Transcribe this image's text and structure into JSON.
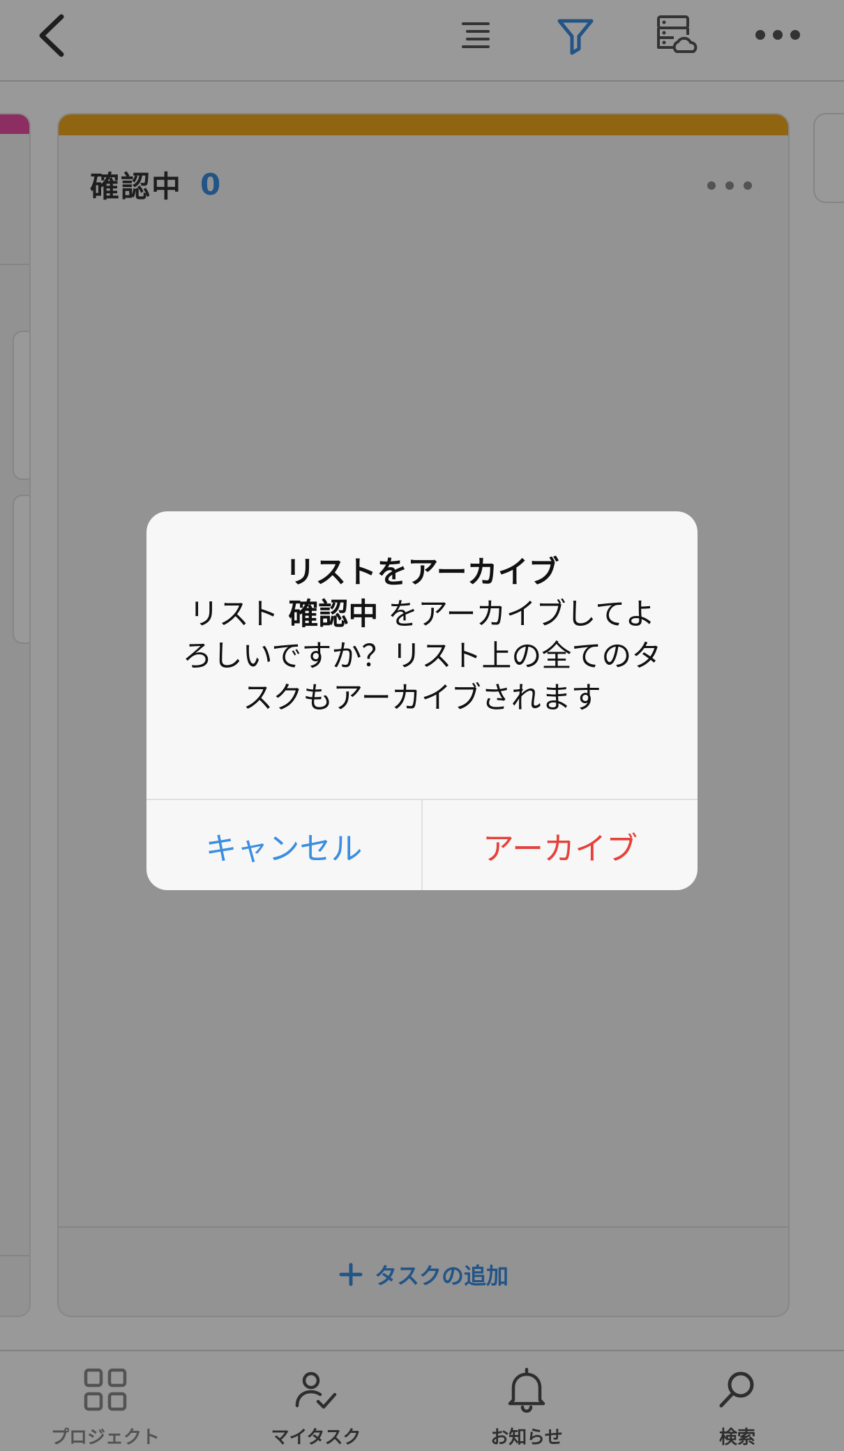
{
  "header": {
    "back_icon": "chevron-left-icon",
    "list_icon": "list-icon",
    "filter_icon": "filter-icon",
    "cloud_icon": "server-cloud-icon",
    "more_icon": "more-icon"
  },
  "column": {
    "title": "確認中",
    "count": "0",
    "add_task_label": "タスクの追加",
    "stripe_color": "#f0a81e"
  },
  "prev_column": {
    "stripe_color": "#e94ea2"
  },
  "dialog": {
    "title": "リストをアーカイブ",
    "message_prefix": "リスト ",
    "message_list_name": "確認中",
    "message_suffix": " をアーカイブしてよろしいですか？リスト上の全てのタスクもアーカイブされます",
    "cancel_label": "キャンセル",
    "confirm_label": "アーカイブ"
  },
  "bottom_nav": {
    "projects": "プロジェクト",
    "my_tasks": "マイタスク",
    "notifications": "お知らせ",
    "search": "検索"
  },
  "colors": {
    "accent": "#3a8de0",
    "danger": "#e5413b"
  }
}
